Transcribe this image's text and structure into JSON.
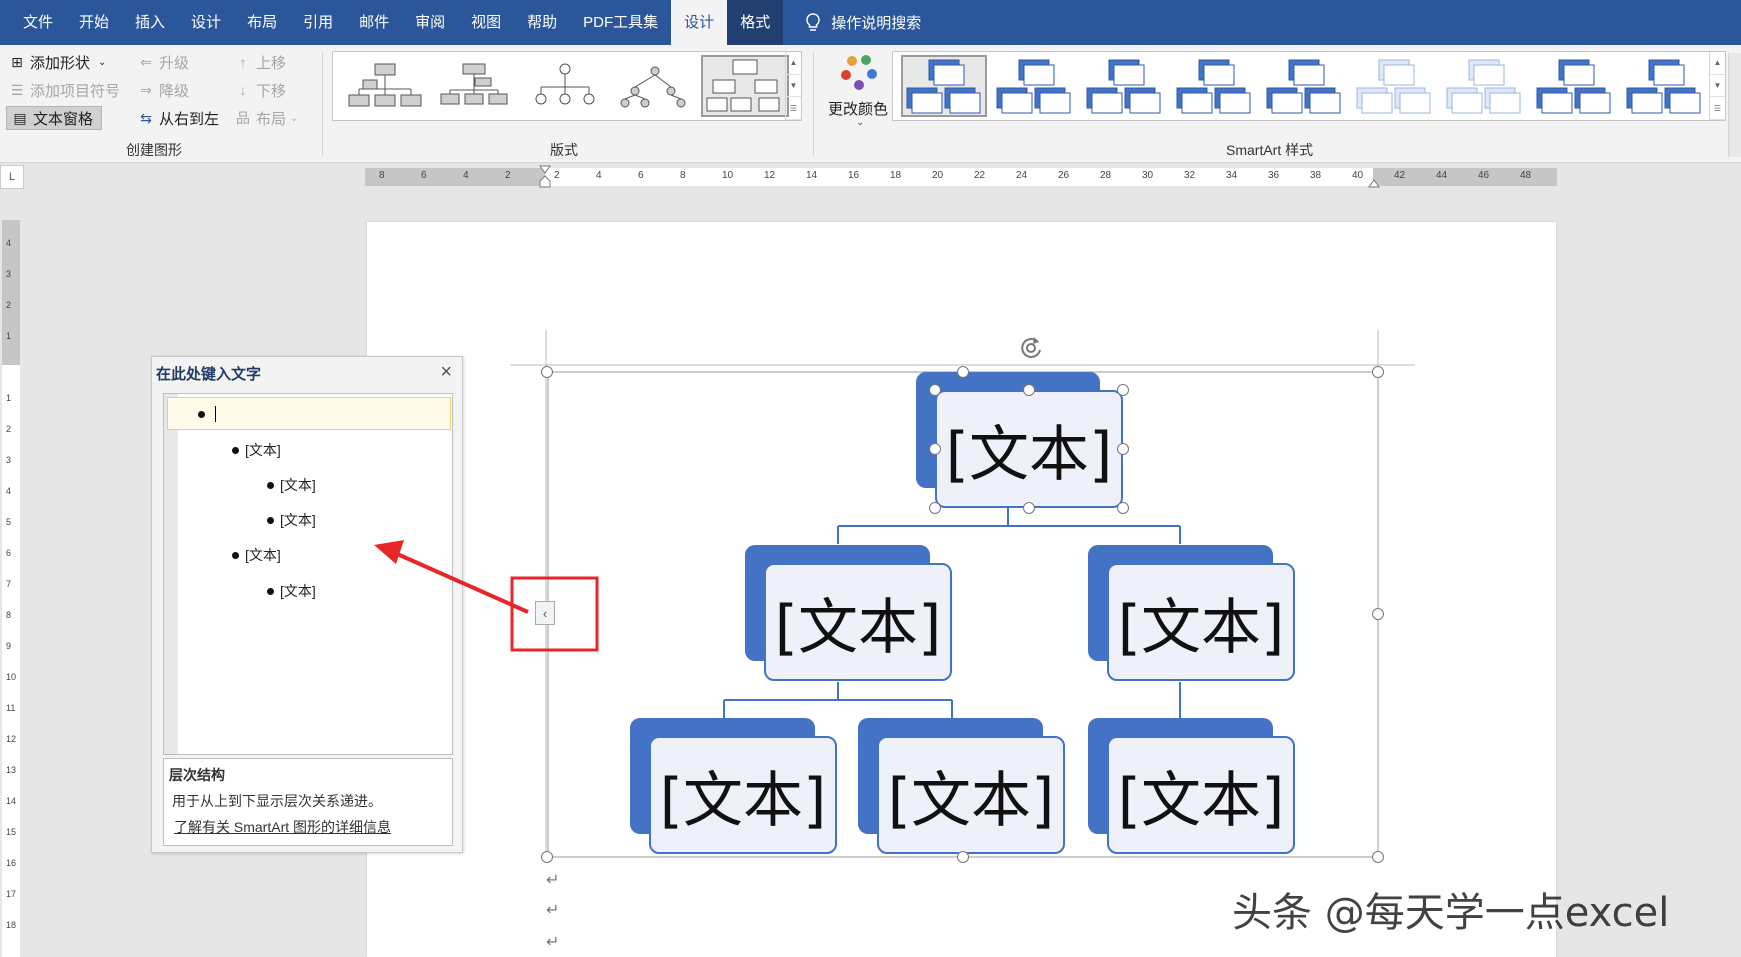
{
  "menubar": {
    "tabs": [
      "文件",
      "开始",
      "插入",
      "设计",
      "布局",
      "引用",
      "邮件",
      "审阅",
      "视图",
      "帮助",
      "PDF工具集",
      "设计",
      "格式"
    ],
    "active_index": 11,
    "search_label": "操作说明搜索"
  },
  "ribbon": {
    "create_group": {
      "add_shape": "添加形状",
      "add_bullet": "添加项目符号",
      "text_pane": "文本窗格",
      "promote": "升级",
      "demote": "降级",
      "rtl": "从右到左",
      "move_up": "上移",
      "move_down": "下移",
      "layout": "布局",
      "label": "创建图形"
    },
    "layouts_label": "版式",
    "change_colors": "更改颜色",
    "styles_label": "SmartArt 样式"
  },
  "ruler": {
    "ticks": [
      "8",
      "6",
      "4",
      "2",
      "2",
      "4",
      "6",
      "8",
      "10",
      "12",
      "14",
      "16",
      "18",
      "20",
      "22",
      "24",
      "26",
      "28",
      "30",
      "32",
      "34",
      "36",
      "38",
      "40",
      "42",
      "44",
      "46",
      "48"
    ]
  },
  "text_pane": {
    "title": "在此处键入文字",
    "items": [
      {
        "text": "",
        "level": 0
      },
      {
        "text": "[文本]",
        "level": 1
      },
      {
        "text": "[文本]",
        "level": 2
      },
      {
        "text": "[文本]",
        "level": 2
      },
      {
        "text": "[文本]",
        "level": 1
      },
      {
        "text": "[文本]",
        "level": 2
      }
    ],
    "info_title": "层次结构",
    "info_desc": "用于从上到下显示层次关系递进。",
    "info_link": "了解有关 SmartArt 图形的详细信息"
  },
  "smartart": {
    "nodes": [
      "[文本]",
      "[文本]",
      "[文本]",
      "[文本]",
      "[文本]",
      "[文本]"
    ],
    "accent_color": "#4472c4",
    "fill_color": "#eef1f9"
  },
  "annotation": {
    "color": "#e8262a"
  },
  "watermark": "头条 @每天学一点excel"
}
